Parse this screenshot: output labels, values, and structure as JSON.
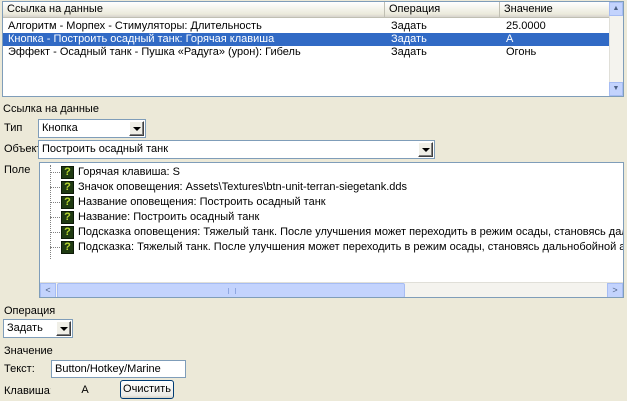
{
  "refs_list": {
    "columns": [
      "Ссылка на данные",
      "Операция",
      "Значение"
    ],
    "rows": [
      {
        "ref": "Алгоритм - Морпех - Стимуляторы: Длительность",
        "op": "Задать",
        "value": "25.0000",
        "selected": false
      },
      {
        "ref": "Кнопка - Построить осадный танк: Горячая клавиша",
        "op": "Задать",
        "value": "A",
        "selected": true
      },
      {
        "ref": "Эффект - Осадный танк - Пушка «Радуга» (урон): Гибель",
        "op": "Задать",
        "value": "Огонь",
        "selected": false
      }
    ]
  },
  "section_label": "Ссылка на данные",
  "type_field": {
    "label": "Тип",
    "value": "Кнопка"
  },
  "object_field": {
    "label": "Объект",
    "value": "Построить осадный танк"
  },
  "field_tree": {
    "label": "Поле",
    "items": [
      "Горячая клавиша: S",
      "Значок оповещения: Assets\\Textures\\btn-unit-terran-siegetank.dds",
      "Название оповещения: Построить осадный танк",
      "Название: Построить осадный танк",
      "Подсказка оповещения: Тяжелый танк. После улучшения может переходить в режим осады, становясь дальнобойно",
      "Подсказка: Тяжелый танк. После улучшения может переходить в режим осады, становясь дальнобойной артиллери"
    ],
    "icon_glyph": "?"
  },
  "operation": {
    "label": "Операция",
    "value": "Задать"
  },
  "value_section": {
    "label": "Значение",
    "text_label": "Текст:",
    "text_value": "Button/Hotkey/Marine",
    "key_label": "Клавиша:",
    "key_value": "A",
    "clear_button": "Очистить"
  },
  "scroll_glyphs": {
    "up": "▲",
    "down": "▼",
    "left": "<",
    "right": ">"
  }
}
